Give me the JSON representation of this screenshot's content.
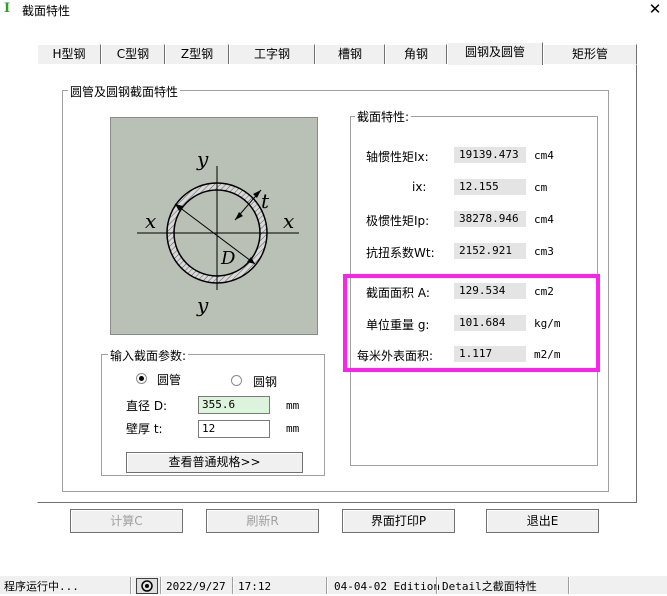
{
  "window": {
    "title": "截面特性",
    "close_glyph": "✕"
  },
  "tabs": [
    "H型钢",
    "C型钢",
    "Z型钢",
    "工字钢",
    "槽钢",
    "角钢",
    "圆钢及圆管",
    "矩形管"
  ],
  "active_tab": "圆钢及圆管",
  "outer_group": {
    "title": "圆管及圆钢截面特性"
  },
  "diagram": {
    "labels": {
      "y_top": "y",
      "y_bottom": "y",
      "x_left": "x",
      "x_right": "x",
      "t": "t",
      "D": "D"
    }
  },
  "properties": {
    "title": "截面特性:",
    "rows": [
      {
        "label": "轴惯性矩Ix:",
        "value": "19139.473",
        "unit": "cm4"
      },
      {
        "label": "ix:",
        "value": "12.155",
        "unit": "cm"
      },
      {
        "label": "极惯性矩Ip:",
        "value": "38278.946",
        "unit": "cm4"
      },
      {
        "label": "抗扭系数Wt:",
        "value": "2152.921",
        "unit": "cm3"
      },
      {
        "label": "截面面积 A:",
        "value": "129.534",
        "unit": "cm2"
      },
      {
        "label": "单位重量 g:",
        "value": "101.684",
        "unit": "kg/m"
      },
      {
        "label": "每米外表面积:",
        "value": "1.117",
        "unit": "m2/m"
      }
    ]
  },
  "input_group": {
    "title": "输入截面参数:",
    "radio_pipe": "圆管",
    "radio_bar": "圆钢",
    "selected": "圆管",
    "diameter_label": "直径 D:",
    "diameter_value": "355.6",
    "diameter_unit": "mm",
    "thickness_label": "壁厚 t:",
    "thickness_value": "12",
    "thickness_unit": "mm",
    "spec_button": "查看普通规格>>"
  },
  "buttons": {
    "calc": "计算C",
    "refresh": "刷新R",
    "print": "界面打印P",
    "exit": "退出E"
  },
  "status": {
    "running": "程序运行中...",
    "date": "2022/9/27",
    "time": "17:12",
    "edition": "04-04-02 Edition",
    "module": "Detail之截面特性"
  },
  "colors": {
    "highlight": "#ff22ee",
    "diagram_bg": "#b9c0b6",
    "readout_bg": "#e4e4e4",
    "input_green": "#dcf4dc"
  }
}
